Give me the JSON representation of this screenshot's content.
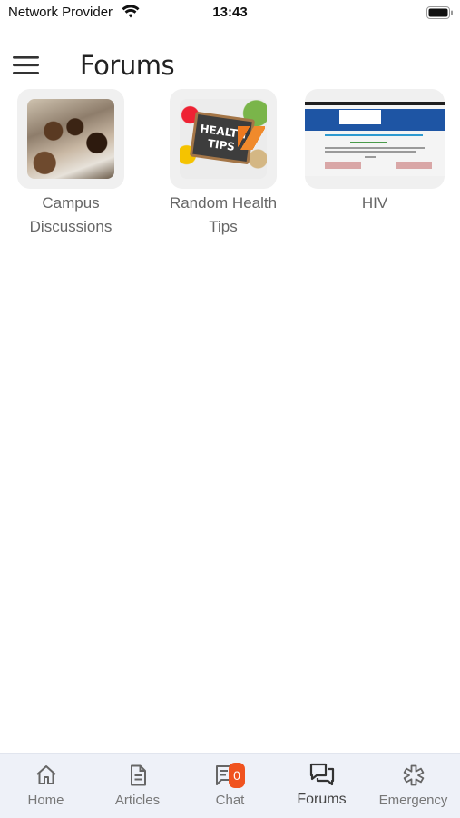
{
  "status_bar": {
    "carrier": "Network Provider",
    "time": "13:43"
  },
  "header": {
    "title": "Forums"
  },
  "forums": [
    {
      "label": "Campus Discussions"
    },
    {
      "label": "Random Health Tips",
      "image_text": "HEALTH TIPS"
    },
    {
      "label": "HIV"
    }
  ],
  "bottom_nav": {
    "items": [
      {
        "label": "Home",
        "icon": "home-icon"
      },
      {
        "label": "Articles",
        "icon": "document-icon"
      },
      {
        "label": "Chat",
        "icon": "chat-icon",
        "badge": "0"
      },
      {
        "label": "Forums",
        "icon": "forum-icon",
        "active": true
      },
      {
        "label": "Emergency",
        "icon": "emergency-icon"
      }
    ]
  },
  "colors": {
    "badge": "#f0531f",
    "nav_background": "#eef1f8",
    "tile_background": "#f0f0f0"
  }
}
